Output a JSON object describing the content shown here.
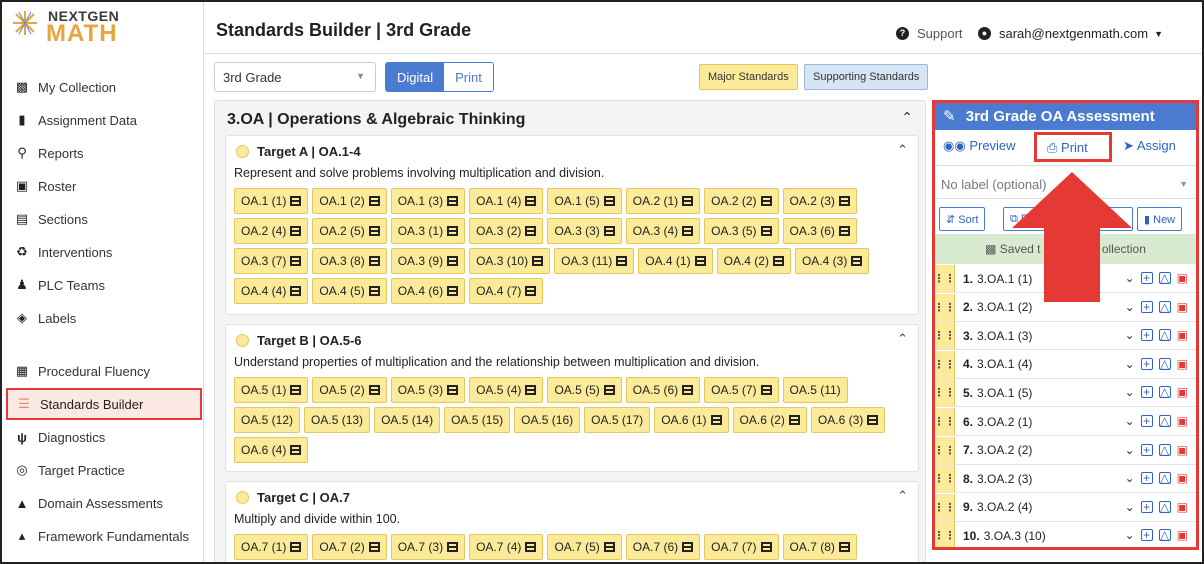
{
  "app": {
    "logo_top": "NEXTGEN",
    "logo_bottom": "MATH",
    "title": "Standards Builder | 3rd Grade"
  },
  "header": {
    "support_label": "Support",
    "user_email": "sarah@nextgenmath.com"
  },
  "sidebar": {
    "items": [
      {
        "label": "My Collection",
        "icon": "collection-icon"
      },
      {
        "label": "Assignment Data",
        "icon": "bar-chart-icon"
      },
      {
        "label": "Reports",
        "icon": "search-icon"
      },
      {
        "label": "Roster",
        "icon": "id-card-icon"
      },
      {
        "label": "Sections",
        "icon": "sections-icon"
      },
      {
        "label": "Interventions",
        "icon": "interventions-icon"
      },
      {
        "label": "PLC Teams",
        "icon": "team-icon"
      },
      {
        "label": "Labels",
        "icon": "tag-icon"
      },
      {
        "label": "Procedural Fluency",
        "icon": "grid-icon"
      },
      {
        "label": "Standards Builder",
        "icon": "list-icon",
        "active": true
      },
      {
        "label": "Diagnostics",
        "icon": "stethoscope-icon"
      },
      {
        "label": "Target Practice",
        "icon": "target-icon"
      },
      {
        "label": "Domain Assessments",
        "icon": "cubes-icon"
      },
      {
        "label": "Framework Fundamentals",
        "icon": "pyramid-icon"
      }
    ]
  },
  "toolbar": {
    "grade_value": "3rd Grade",
    "digital_label": "Digital",
    "print_label": "Print",
    "major_label": "Major Standards",
    "supporting_label": "Supporting Standards"
  },
  "domain": {
    "title": "3.OA | Operations & Algebraic Thinking",
    "targets": [
      {
        "title": "Target A | OA.1-4",
        "description": "Represent and solve problems involving multiplication and division.",
        "chips": [
          {
            "label": "OA.1 (1)",
            "video": true
          },
          {
            "label": "OA.1 (2)",
            "video": true
          },
          {
            "label": "OA.1 (3)",
            "video": true
          },
          {
            "label": "OA.1 (4)",
            "video": true
          },
          {
            "label": "OA.1 (5)",
            "video": true
          },
          {
            "label": "OA.2 (1)",
            "video": true
          },
          {
            "label": "OA.2 (2)",
            "video": true
          },
          {
            "label": "OA.2 (3)",
            "video": true
          },
          {
            "label": "OA.2 (4)",
            "video": true
          },
          {
            "label": "OA.2 (5)",
            "video": true
          },
          {
            "label": "OA.3 (1)",
            "video": true
          },
          {
            "label": "OA.3 (2)",
            "video": true
          },
          {
            "label": "OA.3 (3)",
            "video": true
          },
          {
            "label": "OA.3 (4)",
            "video": true
          },
          {
            "label": "OA.3 (5)",
            "video": true
          },
          {
            "label": "OA.3 (6)",
            "video": true
          },
          {
            "label": "OA.3 (7)",
            "video": true
          },
          {
            "label": "OA.3 (8)",
            "video": true
          },
          {
            "label": "OA.3 (9)",
            "video": true
          },
          {
            "label": "OA.3 (10)",
            "video": true
          },
          {
            "label": "OA.3 (11)",
            "video": true
          },
          {
            "label": "OA.4 (1)",
            "video": true
          },
          {
            "label": "OA.4 (2)",
            "video": true
          },
          {
            "label": "OA.4 (3)",
            "video": true
          },
          {
            "label": "OA.4 (4)",
            "video": true
          },
          {
            "label": "OA.4 (5)",
            "video": true
          },
          {
            "label": "OA.4 (6)",
            "video": true
          },
          {
            "label": "OA.4 (7)",
            "video": true
          }
        ]
      },
      {
        "title": "Target B | OA.5-6",
        "description": "Understand properties of multiplication and the relationship between multiplication and division.",
        "chips": [
          {
            "label": "OA.5 (1)",
            "video": true
          },
          {
            "label": "OA.5 (2)",
            "video": true
          },
          {
            "label": "OA.5 (3)",
            "video": true
          },
          {
            "label": "OA.5 (4)",
            "video": true
          },
          {
            "label": "OA.5 (5)",
            "video": true
          },
          {
            "label": "OA.5 (6)",
            "video": true
          },
          {
            "label": "OA.5 (7)",
            "video": true
          },
          {
            "label": "OA.5 (11)",
            "video": false
          },
          {
            "label": "OA.5 (12)",
            "video": false
          },
          {
            "label": "OA.5 (13)",
            "video": false
          },
          {
            "label": "OA.5 (14)",
            "video": false
          },
          {
            "label": "OA.5 (15)",
            "video": false
          },
          {
            "label": "OA.5 (16)",
            "video": false
          },
          {
            "label": "OA.5 (17)",
            "video": false
          },
          {
            "label": "OA.6 (1)",
            "video": true
          },
          {
            "label": "OA.6 (2)",
            "video": true
          },
          {
            "label": "OA.6 (3)",
            "video": true
          },
          {
            "label": "OA.6 (4)",
            "video": true
          }
        ]
      },
      {
        "title": "Target C | OA.7",
        "description": "Multiply and divide within 100.",
        "chips": [
          {
            "label": "OA.7 (1)",
            "video": true
          },
          {
            "label": "OA.7 (2)",
            "video": true
          },
          {
            "label": "OA.7 (3)",
            "video": true
          },
          {
            "label": "OA.7 (4)",
            "video": true
          },
          {
            "label": "OA.7 (5)",
            "video": true
          },
          {
            "label": "OA.7 (6)",
            "video": true
          },
          {
            "label": "OA.7 (7)",
            "video": true
          },
          {
            "label": "OA.7 (8)",
            "video": true
          }
        ]
      }
    ]
  },
  "assessment": {
    "title": "3rd Grade OA Assessment",
    "preview_label": "Preview",
    "print_label": "Print",
    "assign_label": "Assign",
    "label_placeholder": "No label (optional)",
    "sort_label": "Sort",
    "remove_label": "Re",
    "duplicates_label": "ates",
    "new_label": "New",
    "saved_label": "Saved t",
    "saved_label_end": "ollection",
    "questions": [
      {
        "num": "1.",
        "code": "3.OA.1 (1)"
      },
      {
        "num": "2.",
        "code": "3.OA.1 (2)"
      },
      {
        "num": "3.",
        "code": "3.OA.1 (3)"
      },
      {
        "num": "4.",
        "code": "3.OA.1 (4)"
      },
      {
        "num": "5.",
        "code": "3.OA.1 (5)"
      },
      {
        "num": "6.",
        "code": "3.OA.2 (1)"
      },
      {
        "num": "7.",
        "code": "3.OA.2 (2)"
      },
      {
        "num": "8.",
        "code": "3.OA.2 (3)"
      },
      {
        "num": "9.",
        "code": "3.OA.2 (4)"
      },
      {
        "num": "10.",
        "code": "3.OA.3 (10)"
      }
    ]
  },
  "colors": {
    "accent_blue": "#4a7bd1",
    "highlight_red": "#e53935",
    "chip_yellow": "#fbea9a",
    "logo_orange": "#e9a43b"
  }
}
